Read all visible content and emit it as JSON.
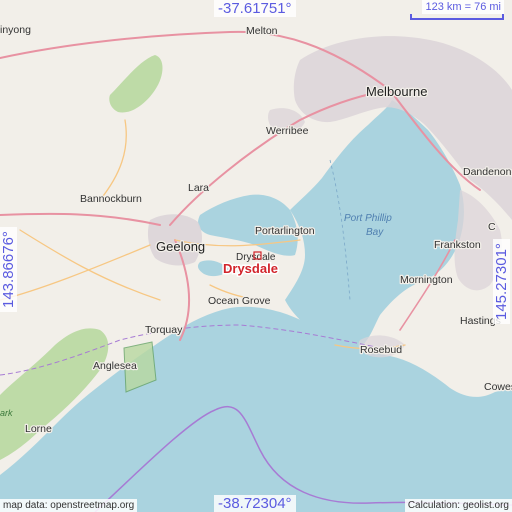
{
  "coordinates": {
    "north": "-37.61751°",
    "south": "-38.72304°",
    "west": "143.86676°",
    "east": "145.27301°"
  },
  "scale": {
    "label": "123 km = 76 mi"
  },
  "attribution": {
    "left": "map data: openstreetmap.org",
    "right": "Calculation: geolist.org"
  },
  "focus_place": "Drysdale",
  "places": {
    "melton": "Melton",
    "melbourne": "Melbourne",
    "werribee": "Werribee",
    "dandenong": "Dandenong",
    "bannockburn": "Bannockburn",
    "lara": "Lara",
    "geelong": "Geelong",
    "portarlington": "Portarlington",
    "drysdale_small": "Drysdale",
    "frankston": "Frankston",
    "mornington": "Mornington",
    "ocean_grove": "Ocean Grove",
    "torquay": "Torquay",
    "hastings": "Hastings",
    "rosebud": "Rosebud",
    "anglesea": "Anglesea",
    "lorne": "Lorne",
    "cowes": "Cowes",
    "inyong": "inyong",
    "c_edge": "C"
  },
  "water": {
    "bay_line1": "Port Phillip",
    "bay_line2": "Bay"
  },
  "park": {
    "label": "ark"
  },
  "colors": {
    "land": "#f2efe9",
    "water": "#aad3df",
    "urban": "#dcd4d8",
    "park": "#b8d8a0",
    "boundary": "#a77bd4",
    "accent": "#5b5be0",
    "focus": "#d2242b"
  }
}
